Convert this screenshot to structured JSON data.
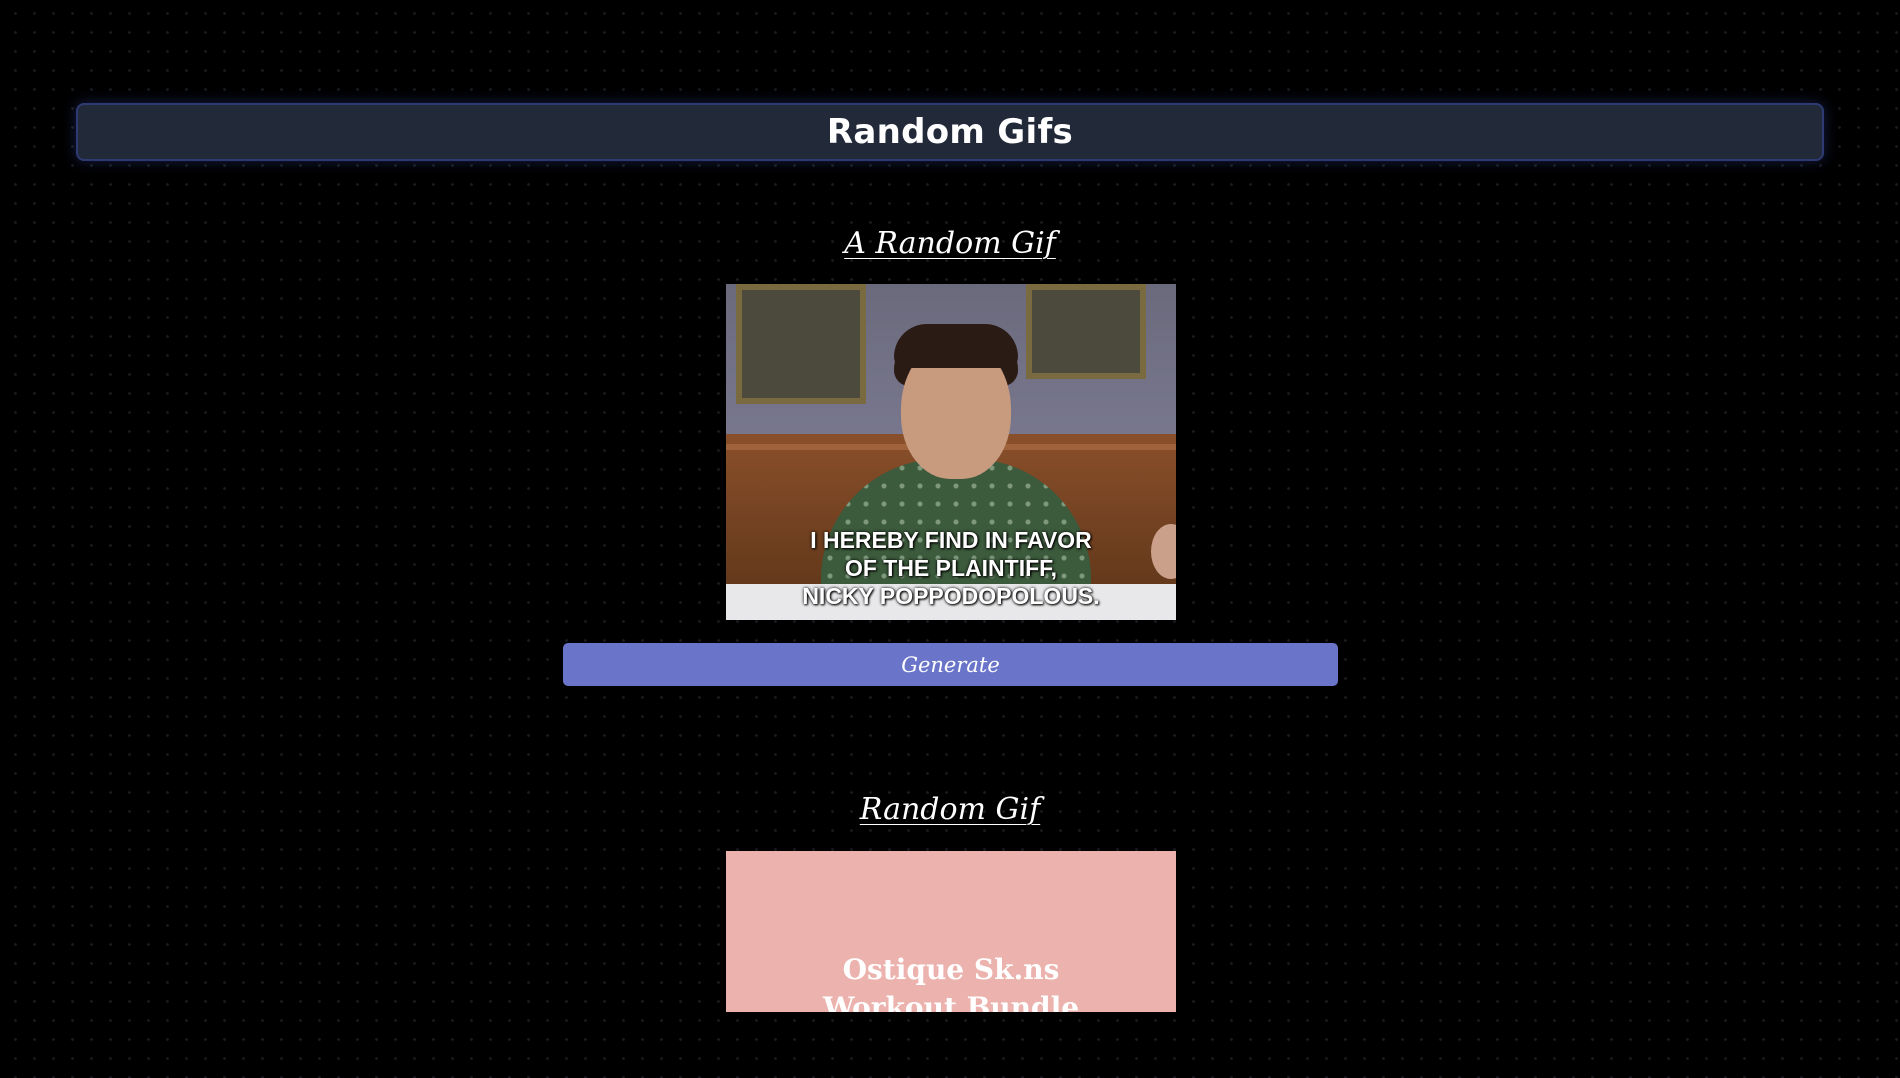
{
  "header": {
    "title": "Random Gifs"
  },
  "sections": [
    {
      "title": "A Random Gif",
      "gif_caption": [
        "I HEREBY FIND IN FAVOR",
        "OF THE PLAINTIFF,",
        "NICKY POPPODOPOLOUS."
      ],
      "button_label": "Generate"
    },
    {
      "title": "Random Gif",
      "gif_caption": [
        "Ostique Sk.ns",
        "Workout Bundle"
      ]
    }
  ],
  "colors": {
    "background": "#000000",
    "header_bg": "#222a3a",
    "header_border": "#2e3a73",
    "button_bg": "#6a75c9",
    "gif2_bg": "#ecb2ad"
  }
}
